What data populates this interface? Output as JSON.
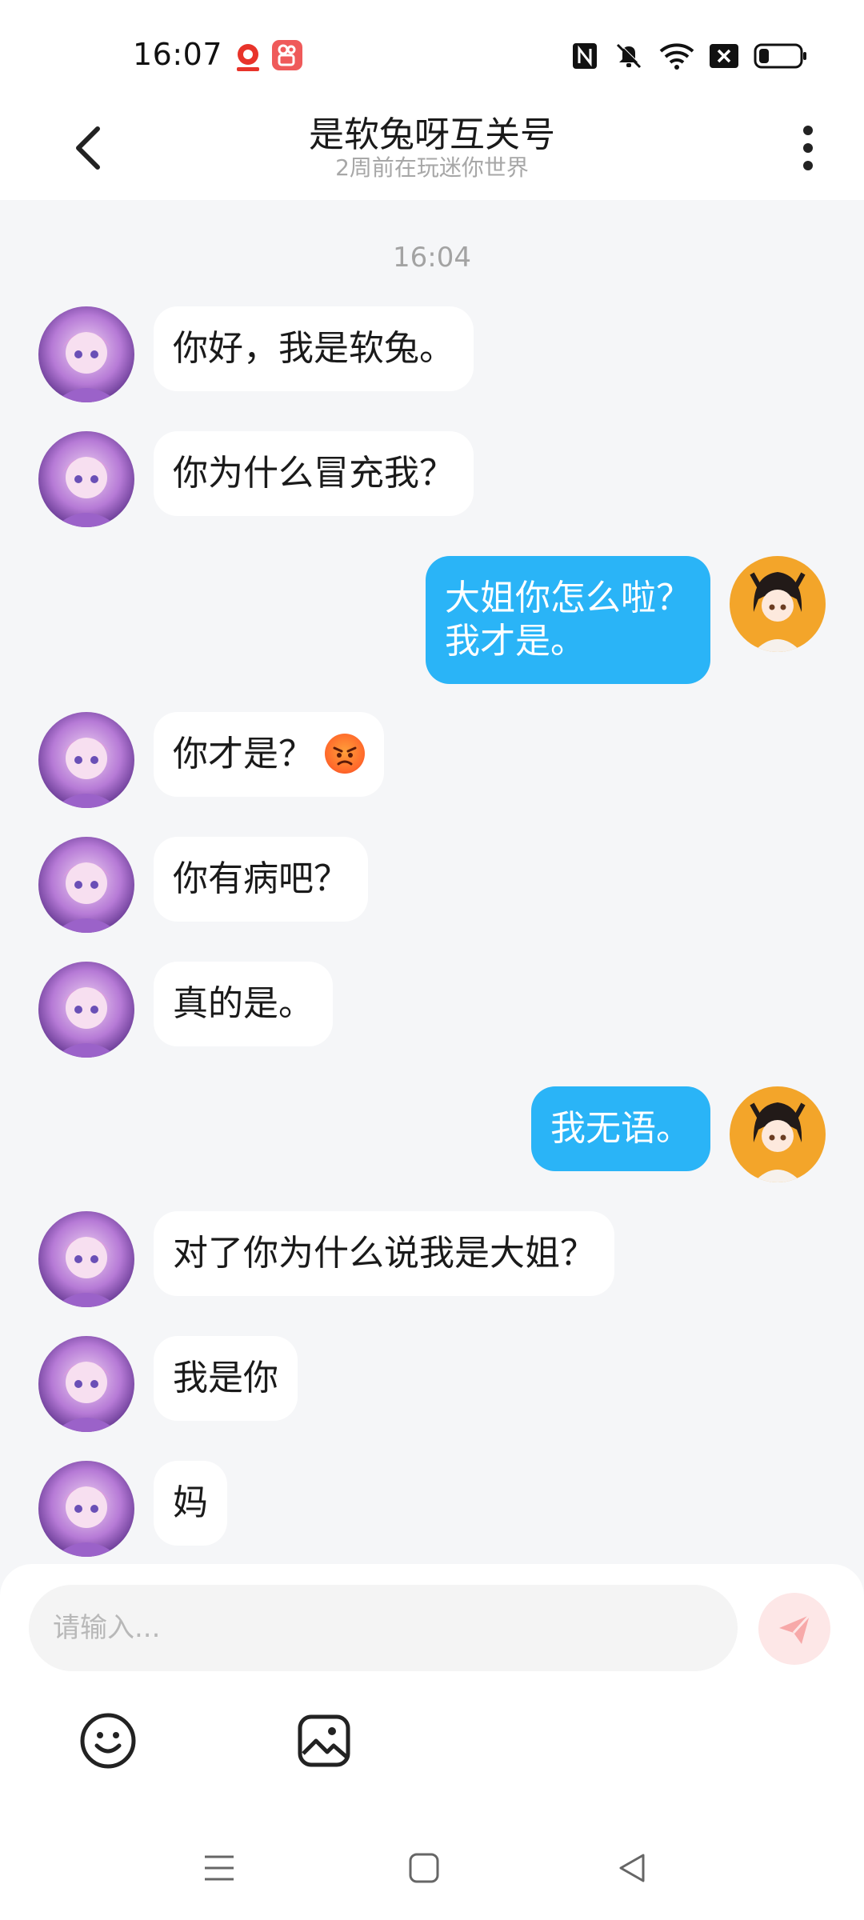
{
  "status_bar": {
    "time": "16:07",
    "icons": [
      "app-notification-icon",
      "kuaishou-app-icon",
      "nfc-icon",
      "mute-icon",
      "wifi-icon",
      "sim-blocked-icon",
      "battery-icon"
    ]
  },
  "header": {
    "title": "是软兔呀互关号",
    "subtitle": "2周前在玩迷你世界",
    "back_icon": "chevron-left-icon",
    "more_icon": "more-vertical-icon"
  },
  "chat": {
    "timestamp": "16:04",
    "messages": [
      {
        "side": "left",
        "text": "你好，我是软兔。"
      },
      {
        "side": "left",
        "text": "你为什么冒充我？"
      },
      {
        "side": "right",
        "text": "大姐你怎么啦？\n我才是。"
      },
      {
        "side": "left",
        "text": "你才是？",
        "emoji": "angry-face"
      },
      {
        "side": "left",
        "text": "你有病吧？"
      },
      {
        "side": "left",
        "text": "真的是。"
      },
      {
        "side": "right",
        "text": "我无语。"
      },
      {
        "side": "left",
        "text": "对了你为什么说我是大姐？"
      },
      {
        "side": "left",
        "text": "我是你"
      },
      {
        "side": "left",
        "text": "妈"
      }
    ]
  },
  "composer": {
    "placeholder": "请输入...",
    "value": "",
    "send_icon": "send-icon",
    "tools": [
      "emoji-icon",
      "image-icon"
    ]
  },
  "colors": {
    "bubble_right": "#2ab4f7",
    "bubble_left": "#ffffff",
    "chat_background": "#f5f6f8",
    "send_button": "#fde7e7"
  },
  "nav_bar": {
    "icons": [
      "menu-icon",
      "home-icon",
      "back-icon"
    ]
  }
}
